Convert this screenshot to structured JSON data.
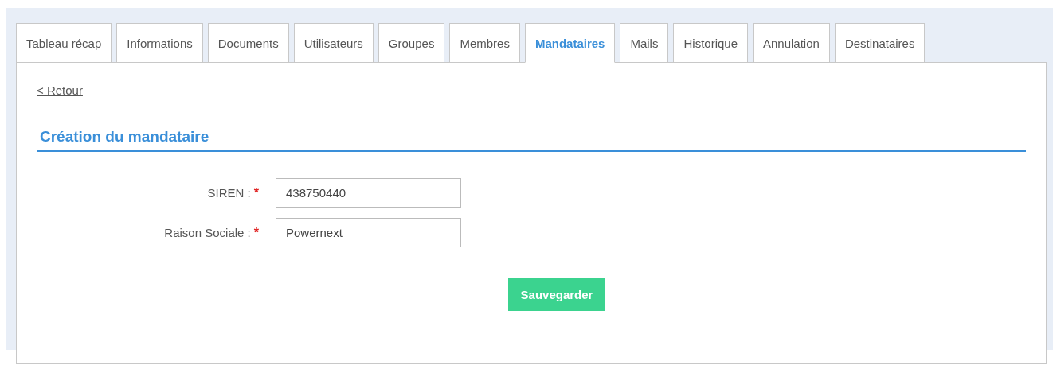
{
  "tabs": [
    {
      "label": "Tableau récap",
      "selected": false
    },
    {
      "label": "Informations",
      "selected": false
    },
    {
      "label": "Documents",
      "selected": false
    },
    {
      "label": "Utilisateurs",
      "selected": false
    },
    {
      "label": "Groupes",
      "selected": false
    },
    {
      "label": "Membres",
      "selected": false
    },
    {
      "label": "Mandataires",
      "selected": true
    },
    {
      "label": "Mails",
      "selected": false
    },
    {
      "label": "Historique",
      "selected": false
    },
    {
      "label": "Annulation",
      "selected": false
    },
    {
      "label": "Destinataires",
      "selected": false
    }
  ],
  "back_link": "< Retour",
  "section_title": "Création du mandataire",
  "fields": [
    {
      "label": "SIREN :",
      "required_mark": "*",
      "value": "438750440"
    },
    {
      "label": "Raison Sociale :",
      "required_mark": "*",
      "value": "Powernext"
    }
  ],
  "save_button": "Sauvegarder"
}
